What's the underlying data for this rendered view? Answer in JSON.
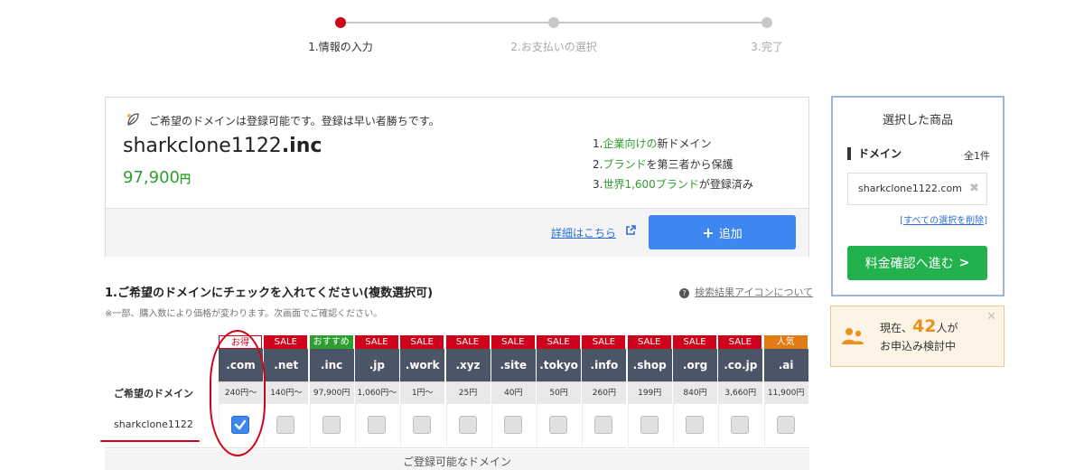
{
  "stepper": {
    "steps": [
      {
        "label": "1.情報の入力",
        "active": true
      },
      {
        "label": "2.お支払いの選択",
        "active": false
      },
      {
        "label": "3.完了",
        "active": false
      }
    ]
  },
  "result": {
    "availability_message": "ご希望のドメインは登録可能です。登録は早い者勝ちです。",
    "domain_base": "sharkclone1122",
    "domain_tld": ".inc",
    "price_value": "97,900",
    "price_unit": "円",
    "features": [
      {
        "num": "1.",
        "hl": "企業向けの",
        "rest": "新ドメイン"
      },
      {
        "num": "2.",
        "hl": "ブランド",
        "rest": "を第三者から保護"
      },
      {
        "num": "3.",
        "hl": "世界1,600ブランド",
        "rest": "が登録済み"
      }
    ],
    "detail_link": "詳細はこちら",
    "add_button": "追加"
  },
  "selection": {
    "title": "1.ご希望のドメインにチェックを入れてください(複数選択可)",
    "note": "※一部、購入数により価格が変わります。次画面でご確認ください。",
    "help_link": "検索結果アイコンについて",
    "row_header": "ご希望のドメイン",
    "domain_label": "sharkclone1122",
    "footer": "ご登録可能なドメイン",
    "tlds": [
      {
        "badge": "お得",
        "badge_type": "otoku",
        "tld": ".com",
        "price": "240円〜",
        "checked": true
      },
      {
        "badge": "SALE",
        "badge_type": "sale",
        "tld": ".net",
        "price": "140円〜",
        "checked": false
      },
      {
        "badge": "おすすめ",
        "badge_type": "recommend",
        "tld": ".inc",
        "price": "97,900円",
        "checked": false
      },
      {
        "badge": "SALE",
        "badge_type": "sale",
        "tld": ".jp",
        "price": "1,060円〜",
        "checked": false
      },
      {
        "badge": "SALE",
        "badge_type": "sale",
        "tld": ".work",
        "price": "1円〜",
        "checked": false
      },
      {
        "badge": "SALE",
        "badge_type": "sale",
        "tld": ".xyz",
        "price": "25円",
        "checked": false
      },
      {
        "badge": "SALE",
        "badge_type": "sale",
        "tld": ".site",
        "price": "40円",
        "checked": false
      },
      {
        "badge": "SALE",
        "badge_type": "sale",
        "tld": ".tokyo",
        "price": "50円",
        "checked": false
      },
      {
        "badge": "SALE",
        "badge_type": "sale",
        "tld": ".info",
        "price": "260円",
        "checked": false
      },
      {
        "badge": "SALE",
        "badge_type": "sale",
        "tld": ".shop",
        "price": "199円",
        "checked": false
      },
      {
        "badge": "SALE",
        "badge_type": "sale",
        "tld": ".org",
        "price": "840円",
        "checked": false
      },
      {
        "badge": "SALE",
        "badge_type": "sale",
        "tld": ".co.jp",
        "price": "3,660円",
        "checked": false
      },
      {
        "badge": "人気",
        "badge_type": "popular",
        "tld": ".ai",
        "price": "11,900円",
        "checked": false
      }
    ]
  },
  "cart": {
    "title": "選択した商品",
    "section": "ドメイン",
    "count": "全1件",
    "item": "sharkclone1122.com",
    "clear_link": "すべての選択を削除",
    "confirm_button": "料金確認へ進む"
  },
  "notice": {
    "prefix": "現在、",
    "count": "42",
    "suffix": "人が",
    "line2": "お申込み検討中"
  },
  "colors": {
    "sale": "#d0021b",
    "recommend": "#2e9e2e",
    "popular": "#e07b16",
    "accent_blue": "#3f87f0",
    "confirm_green": "#22b14c"
  }
}
